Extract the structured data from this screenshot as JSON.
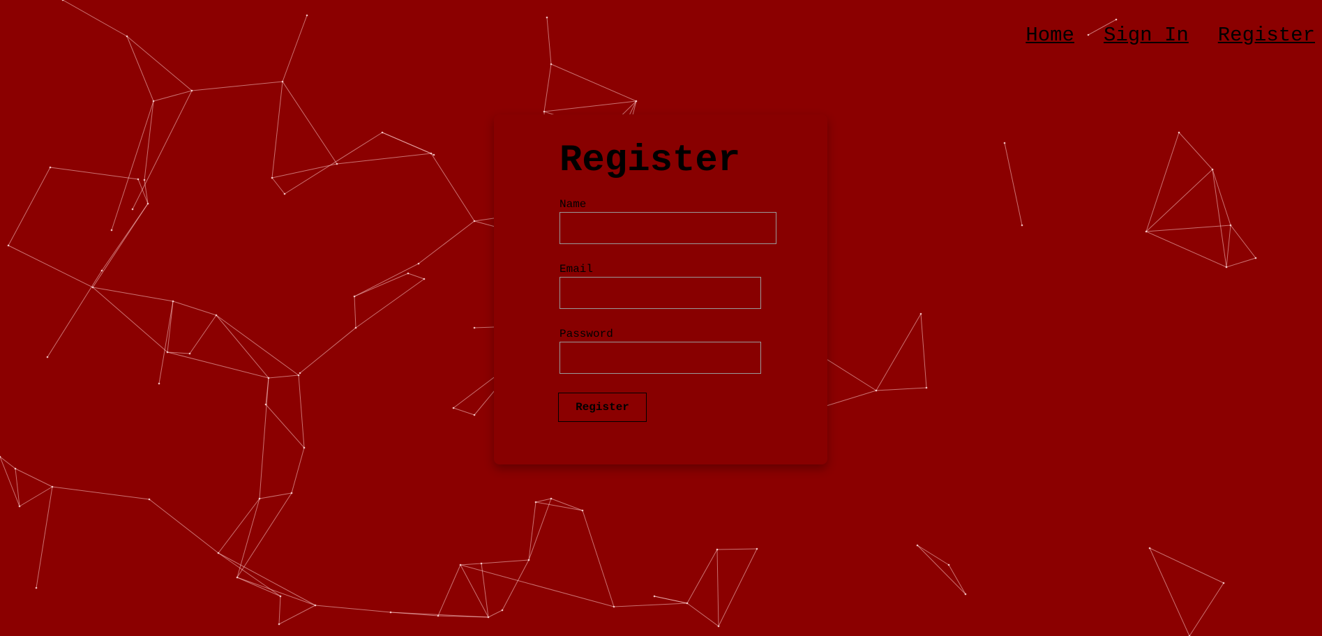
{
  "nav": {
    "items": [
      {
        "label": "Home"
      },
      {
        "label": "Sign In"
      },
      {
        "label": "Register"
      }
    ]
  },
  "form": {
    "title": "Register",
    "fields": [
      {
        "label": "Name",
        "value": ""
      },
      {
        "label": "Email",
        "value": ""
      },
      {
        "label": "Password",
        "value": ""
      }
    ],
    "submit_label": "Register"
  },
  "colors": {
    "background": "#8b0000",
    "card": "#880000",
    "text": "#000000",
    "network_lines": "#ffcdcd"
  }
}
